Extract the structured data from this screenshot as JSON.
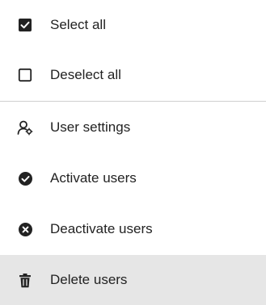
{
  "menu": {
    "items": [
      {
        "label": "Select all",
        "icon": "checkbox-checked-icon"
      },
      {
        "label": "Deselect all",
        "icon": "checkbox-empty-icon"
      },
      {
        "label": "User settings",
        "icon": "user-settings-icon"
      },
      {
        "label": "Activate users",
        "icon": "check-circle-icon"
      },
      {
        "label": "Deactivate users",
        "icon": "x-circle-icon"
      },
      {
        "label": "Delete users",
        "icon": "trash-icon"
      }
    ]
  },
  "colors": {
    "text": "#222222",
    "icon": "#222222",
    "divider": "#cfcfcf",
    "active_background": "#e6e6e6"
  }
}
